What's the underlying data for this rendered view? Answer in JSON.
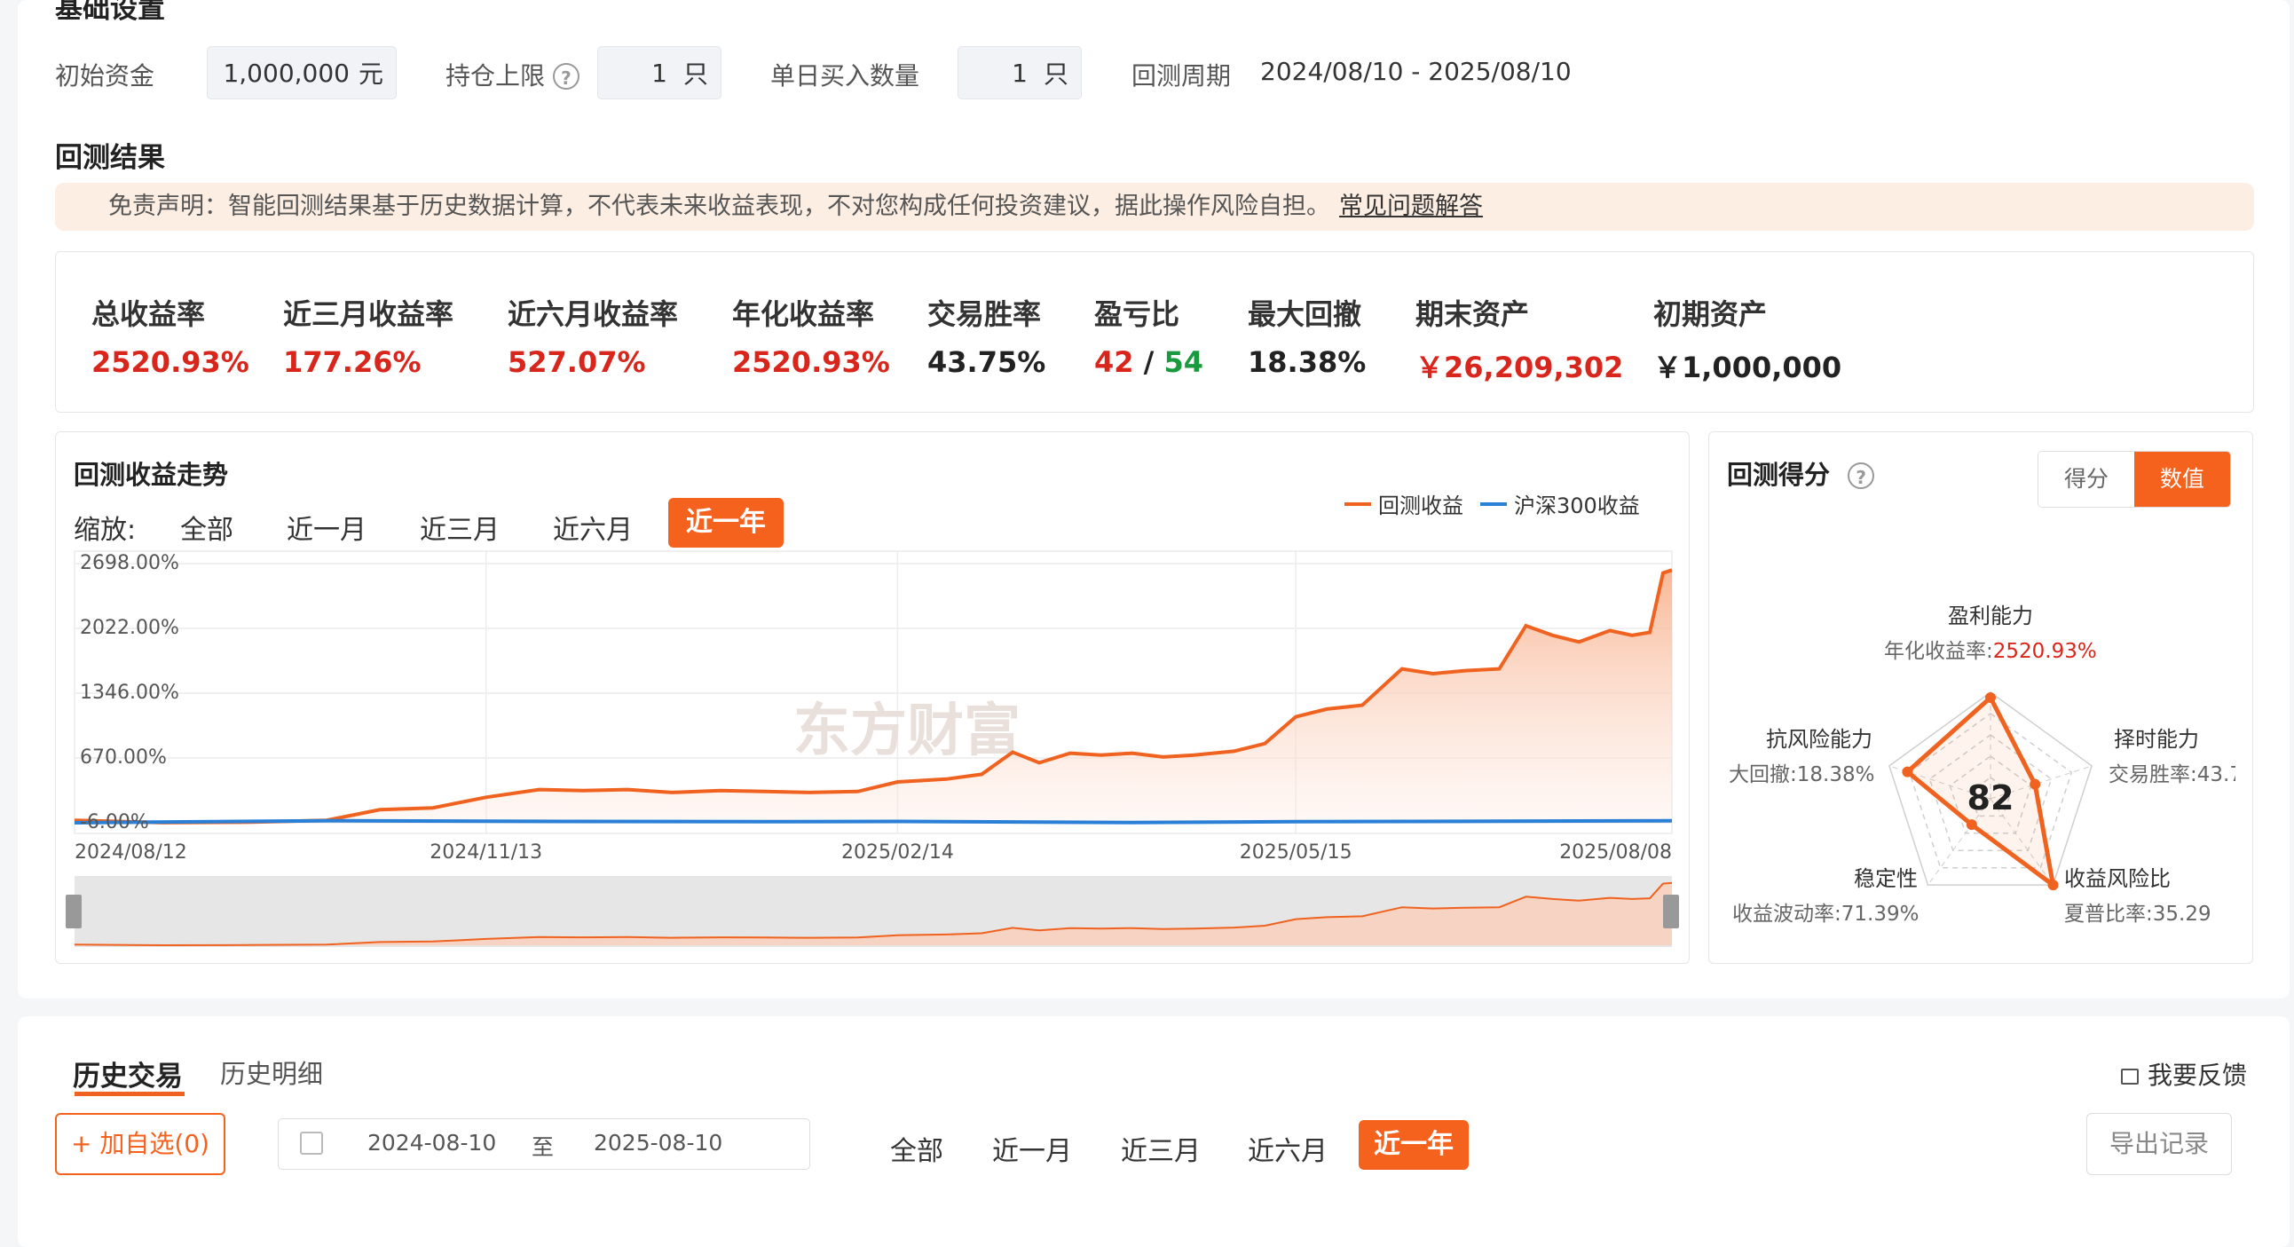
{
  "basic": {
    "title": "基础设置",
    "initial_capital_label": "初始资金",
    "initial_capital_value": "1,000,000",
    "initial_capital_unit": "元",
    "position_limit_label": "持仓上限",
    "position_limit_value": "1",
    "position_limit_unit": "只",
    "daily_buy_label": "单日买入数量",
    "daily_buy_value": "1",
    "daily_buy_unit": "只",
    "period_label": "回测周期",
    "period_value": "2024/08/10 - 2025/08/10"
  },
  "results": {
    "title": "回测结果",
    "disclaimer": "免责声明：智能回测结果基于历史数据计算，不代表未来收益表现，不对您构成任何投资建议，据此操作风险自担。",
    "faq_link": "常见问题解答",
    "stats": [
      {
        "key": "总收益率",
        "value": "2520.93%"
      },
      {
        "key": "近三月收益率",
        "value": "177.26%"
      },
      {
        "key": "近六月收益率",
        "value": "527.07%"
      },
      {
        "key": "年化收益率",
        "value": "2520.93%"
      },
      {
        "key": "交易胜率",
        "value": "43.75%"
      },
      {
        "key": "盈亏比",
        "win": "42",
        "sep": "/",
        "loss": "54"
      },
      {
        "key": "最大回撤",
        "value": "18.38%"
      },
      {
        "key": "期末资产",
        "value": "￥26,209,302"
      },
      {
        "key": "初期资产",
        "value": "￥1,000,000"
      }
    ]
  },
  "trend": {
    "title": "回测收益走势",
    "zoom_label": "缩放:",
    "zoom_options": [
      "全部",
      "近一月",
      "近三月",
      "近六月",
      "近一年"
    ],
    "legend": [
      "回测收益",
      "沪深300收益"
    ],
    "watermark": "东方财富"
  },
  "chart_data": {
    "type": "area",
    "y_tick_labels": [
      "2698.00%",
      "2022.00%",
      "1346.00%",
      "670.00%",
      "-6.00%"
    ],
    "ylim": [
      -6,
      2698
    ],
    "x_tick_labels": [
      "2024/08/12",
      "2024/11/13",
      "2025/02/14",
      "2025/05/15",
      "2025/08/08"
    ],
    "grid": true,
    "legend_position": "top-right",
    "colors": {
      "backtest": "#f0621f",
      "hs300": "#2a7fd6"
    },
    "series": [
      {
        "name": "回测收益",
        "x": [
          "2024/08/12",
          "2024/09/01",
          "2024/09/20",
          "2024/10/08",
          "2024/10/20",
          "2024/11/01",
          "2024/11/13",
          "2024/11/25",
          "2024/12/05",
          "2024/12/15",
          "2024/12/25",
          "2025/01/05",
          "2025/01/15",
          "2025/01/25",
          "2025/02/05",
          "2025/02/14",
          "2025/02/25",
          "2025/03/05",
          "2025/03/12",
          "2025/03/18",
          "2025/03/25",
          "2025/04/01",
          "2025/04/08",
          "2025/04/15",
          "2025/04/22",
          "2025/05/01",
          "2025/05/08",
          "2025/05/15",
          "2025/05/22",
          "2025/05/30",
          "2025/06/08",
          "2025/06/15",
          "2025/06/22",
          "2025/06/30",
          "2025/07/06",
          "2025/07/12",
          "2025/07/18",
          "2025/07/25",
          "2025/07/30",
          "2025/08/03",
          "2025/08/06",
          "2025/08/08"
        ],
        "values": [
          20,
          -5,
          0,
          20,
          130,
          150,
          260,
          340,
          330,
          340,
          310,
          330,
          320,
          310,
          320,
          420,
          450,
          500,
          730,
          620,
          720,
          700,
          720,
          680,
          700,
          740,
          820,
          1100,
          1180,
          1220,
          1600,
          1550,
          1580,
          1600,
          2050,
          1950,
          1880,
          2000,
          1950,
          1980,
          2600,
          2630
        ]
      },
      {
        "name": "沪深300收益",
        "x": [
          "2024/08/12",
          "2024/10/08",
          "2024/11/13",
          "2025/01/15",
          "2025/02/14",
          "2025/04/08",
          "2025/05/15",
          "2025/06/30",
          "2025/08/08"
        ],
        "values": [
          -6,
          15,
          10,
          5,
          8,
          -4,
          5,
          10,
          15
        ]
      }
    ]
  },
  "score": {
    "title": "回测得分",
    "toggle": [
      "得分",
      "数值"
    ],
    "total": "82",
    "dims": [
      {
        "name": "盈利能力",
        "sub": "年化收益率:",
        "subval": "2520.93%",
        "score": 0.95
      },
      {
        "name": "择时能力",
        "sub": "交易胜率:43.7",
        "subval": "",
        "score": 0.44
      },
      {
        "name": "收益风险比",
        "sub": "夏普比率:35.29",
        "subval": "",
        "score": 1.0
      },
      {
        "name": "稳定性",
        "sub": "收益波动率:71.39%",
        "subval": "",
        "score": 0.3
      },
      {
        "name": "抗风险能力",
        "sub": "大回撤:18.38%",
        "subval": "",
        "score": 0.82
      }
    ]
  },
  "history": {
    "tab_active": "历史交易",
    "tab_other": "历史明细",
    "feedback": "我要反馈",
    "add_watch": "+ 加自选(0)",
    "date_start": "2024-08-10",
    "date_to": "至",
    "date_end": "2025-08-10",
    "ranges": [
      "全部",
      "近一月",
      "近三月",
      "近六月",
      "近一年"
    ],
    "export": "导出记录"
  }
}
